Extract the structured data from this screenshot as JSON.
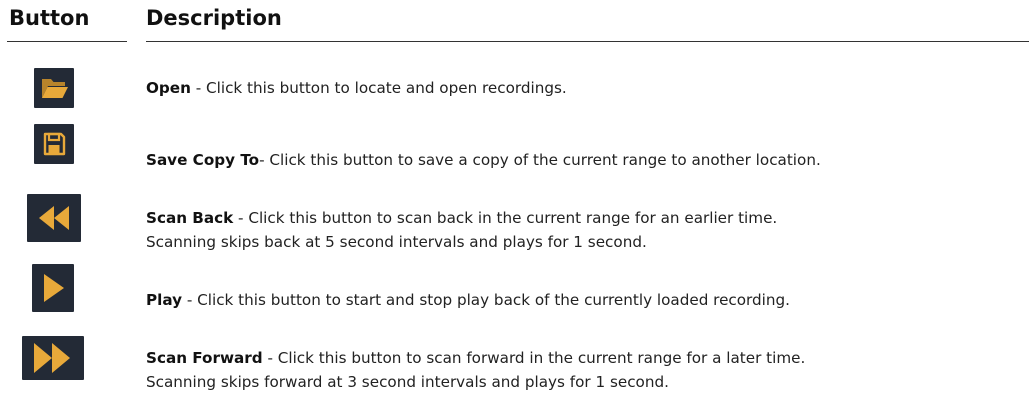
{
  "header": {
    "button_label": "Button",
    "description_label": "Description"
  },
  "accent_color": "#e8a93a",
  "icon_background": "#232a36",
  "rows": [
    {
      "icon": "folder-open-icon",
      "name": "Open",
      "text": " - Click this button to locate and open recordings.",
      "text2": ""
    },
    {
      "icon": "floppy-disk-icon",
      "name": "Save Copy To",
      "text": "- Click this button to save a copy of the current range to another location.",
      "text2": ""
    },
    {
      "icon": "rewind-icon",
      "name": "Scan Back",
      "text": " - Click this button to scan back in the current range for an earlier time.",
      "text2": "Scanning skips back at 5 second intervals and plays for 1 second."
    },
    {
      "icon": "play-icon",
      "name": "Play",
      "text": " - Click this button to start and stop play back of the currently loaded recording.",
      "text2": ""
    },
    {
      "icon": "fast-forward-icon",
      "name": "Scan Forward",
      "text": " - Click this button to scan forward in the current range for a later time.",
      "text2": "Scanning skips forward at 3 second intervals and plays for 1 second."
    }
  ]
}
